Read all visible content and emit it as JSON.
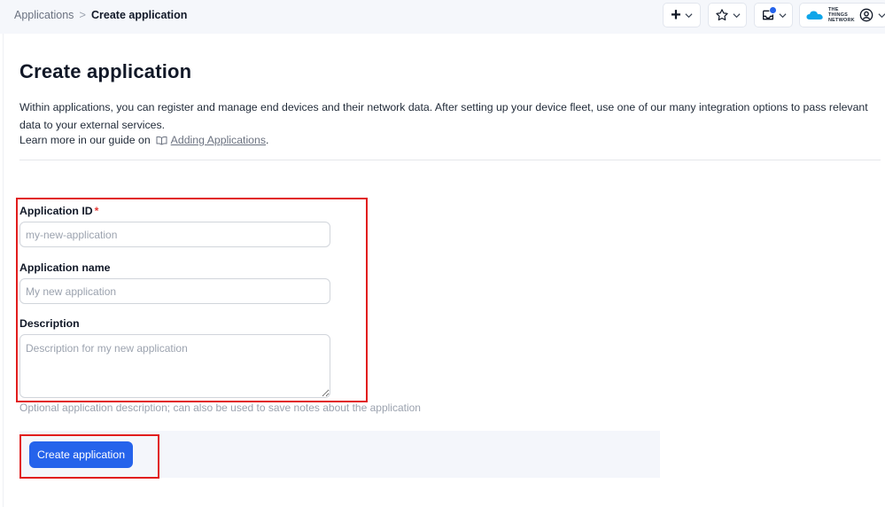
{
  "breadcrumb": {
    "items": [
      {
        "label": "Applications"
      },
      {
        "label": "Create application"
      }
    ],
    "separator": ">"
  },
  "header_actions": {
    "add_icon": "plus-icon",
    "bookmarks_icon": "star-icon",
    "notifications_icon": "inbox-notification-icon",
    "notification_dot_color": "#2563eb",
    "brand_logo_text": "THE THINGS NETWORK",
    "account_icon": "user-circle-icon"
  },
  "page": {
    "title": "Create application",
    "intro_text": "Within applications, you can register and manage end devices and their network data. After setting up your device fleet, use one of our many integration options to pass relevant data to your external services.",
    "guide_prefix": "Learn more in our guide on",
    "guide_link": "Adding Applications",
    "guide_suffix": "."
  },
  "form": {
    "app_id": {
      "label": "Application ID",
      "required_mark": "*",
      "placeholder": "my-new-application",
      "value": ""
    },
    "app_name": {
      "label": "Application name",
      "placeholder": "My new application",
      "value": ""
    },
    "description": {
      "label": "Description",
      "placeholder": "Description for my new application",
      "value": "",
      "hint": "Optional application description; can also be used to save notes about the application"
    },
    "submit_label": "Create application"
  },
  "colors": {
    "accent": "#2563eb",
    "annotation": "#e11d1d",
    "required": "#e53935"
  }
}
